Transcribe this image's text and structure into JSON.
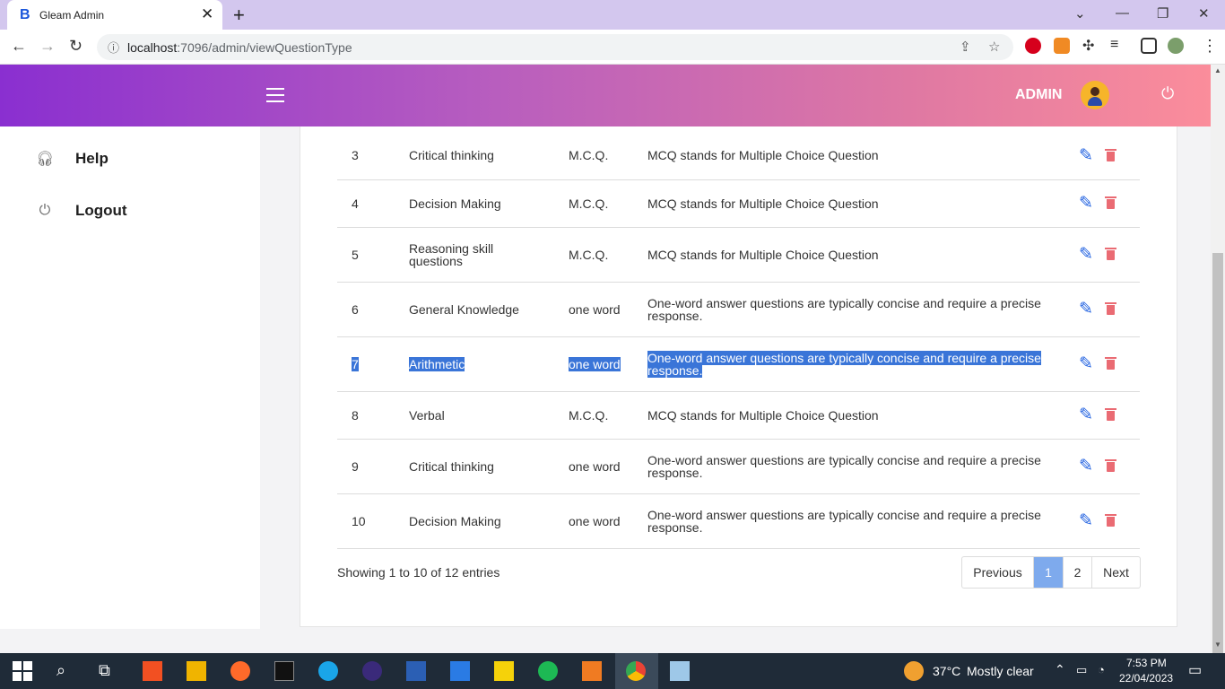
{
  "browser": {
    "tab_title": "Gleam Admin",
    "tab_favicon": "B",
    "url_host": "localhost",
    "url_path": ":7096/admin/viewQuestionType"
  },
  "header": {
    "admin_label": "ADMIN"
  },
  "sidebar": {
    "items": [
      {
        "label": "Help",
        "icon": "headset-icon"
      },
      {
        "label": "Logout",
        "icon": "power-icon"
      }
    ]
  },
  "table": {
    "rows": [
      {
        "id": "3",
        "name": "Critical thinking",
        "type": "M.C.Q.",
        "description": "MCQ stands for Multiple Choice Question"
      },
      {
        "id": "4",
        "name": "Decision Making",
        "type": "M.C.Q.",
        "description": "MCQ stands for Multiple Choice Question"
      },
      {
        "id": "5",
        "name": "Reasoning skill questions",
        "type": "M.C.Q.",
        "description": "MCQ stands for Multiple Choice Question"
      },
      {
        "id": "6",
        "name": "General Knowledge",
        "type": "one word",
        "description": "One-word answer questions are typically concise and require a precise response."
      },
      {
        "id": "7",
        "name": "Arithmetic",
        "type": "one word",
        "description": "One-word answer questions are typically concise and require a precise response."
      },
      {
        "id": "8",
        "name": "Verbal",
        "type": "M.C.Q.",
        "description": "MCQ stands for Multiple Choice Question"
      },
      {
        "id": "9",
        "name": "Critical thinking",
        "type": "one word",
        "description": "One-word answer questions are typically concise and require a precise response."
      },
      {
        "id": "10",
        "name": "Decision Making",
        "type": "one word",
        "description": "One-word answer questions are typically concise and require a precise response."
      }
    ]
  },
  "pagination": {
    "summary": "Showing 1 to 10 of 12 entries",
    "previous": "Previous",
    "pages": [
      "1",
      "2"
    ],
    "next": "Next"
  },
  "taskbar": {
    "temperature": "37°C",
    "weather": "Mostly clear",
    "time": "7:53 PM",
    "date": "22/04/2023"
  },
  "colors": {
    "header_gradient_start": "#8a2fd0",
    "header_gradient_end": "#fb8d9b",
    "edit_icon": "#1e5fe0",
    "delete_icon": "#ea6b73",
    "active_page": "#7eaaed",
    "selection": "#3a75d8"
  }
}
